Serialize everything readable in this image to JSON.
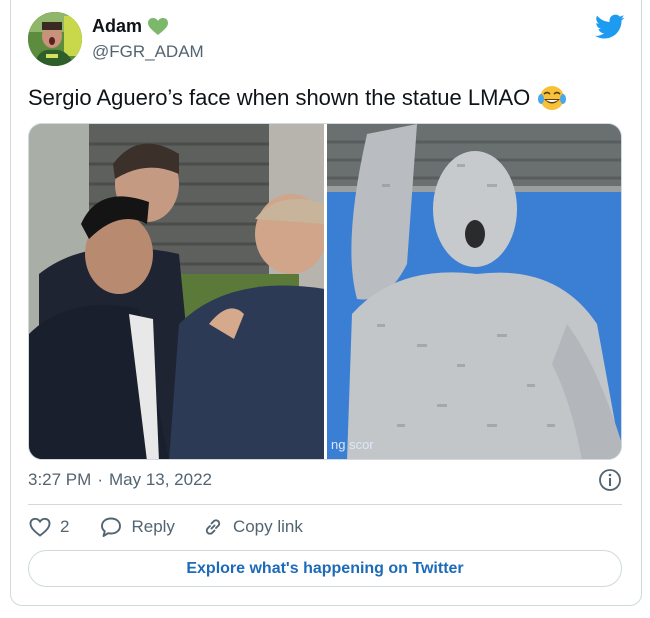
{
  "author": {
    "display_name": "Adam",
    "handle": "@FGR_ADAM",
    "badge_icon": "green-heart-icon"
  },
  "tweet": {
    "text": "Sergio Aguero’s face when shown the statue LMAO",
    "emoji_icon": "tears-of-joy-emoji",
    "media_caption_fragment": "ng scor"
  },
  "meta": {
    "time": "3:27 PM",
    "separator": "·",
    "date": "May 13, 2022"
  },
  "actions": {
    "like_count": "2",
    "reply_label": "Reply",
    "copy_label": "Copy link"
  },
  "explore_label": "Explore what's happening on Twitter",
  "colors": {
    "twitter_blue": "#1d9bf0",
    "link_blue": "#1d6bb8",
    "heart_green": "#7cb86a",
    "muted_text": "#536471"
  }
}
